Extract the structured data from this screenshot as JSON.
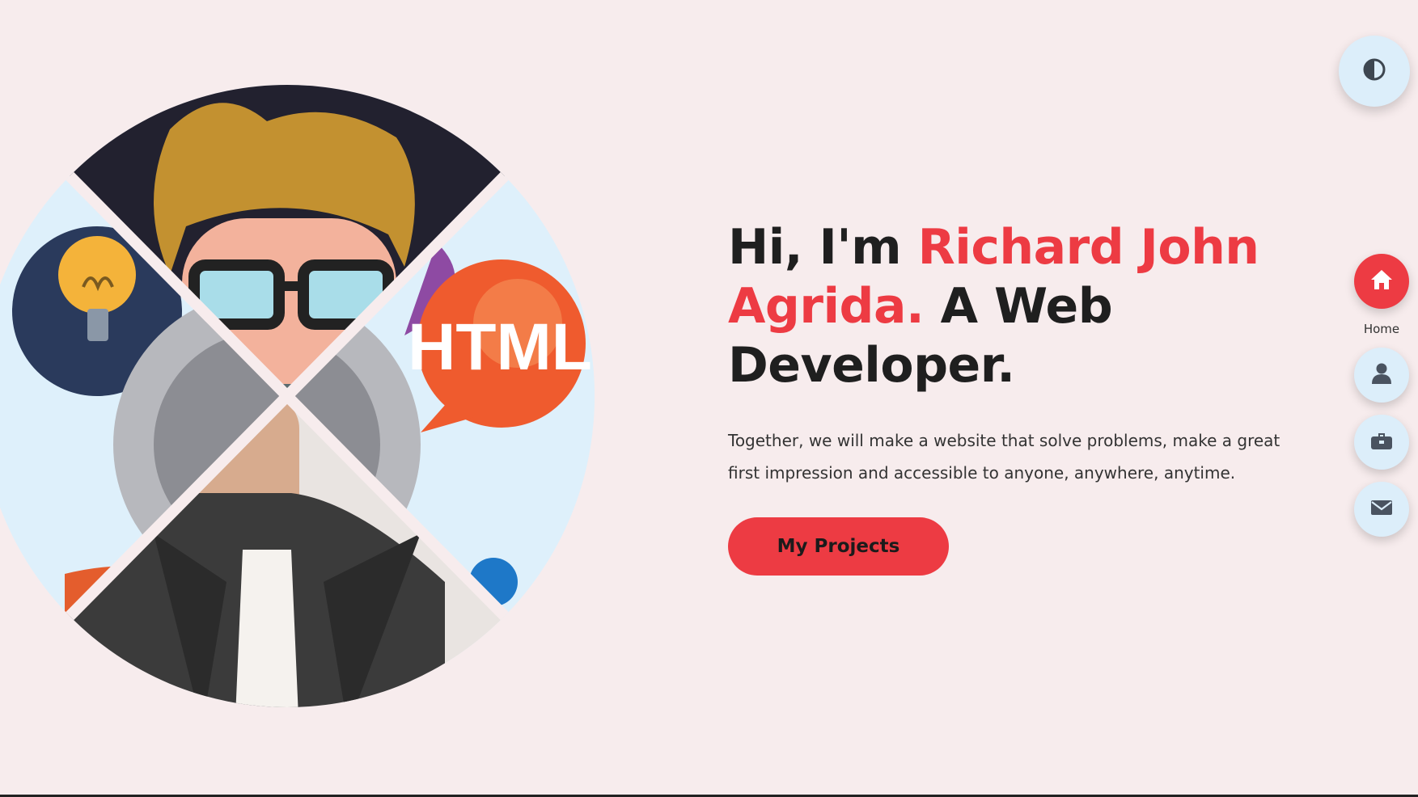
{
  "hero": {
    "title_prefix": "Hi, I'm ",
    "title_name": "Richard John Agrida.",
    "title_suffix": " A Web Developer.",
    "description": "Together, we will make a website that solve problems, make a great first impression and accessible to anyone, anywhere, anytime.",
    "cta_label": "My Projects",
    "illustration_badge": "HTML"
  },
  "nav": {
    "theme_toggle_icon": "contrast-icon",
    "items": [
      {
        "label": "Home",
        "icon": "home-icon",
        "active": true
      },
      {
        "label": "",
        "icon": "user-icon",
        "active": false
      },
      {
        "label": "",
        "icon": "briefcase-icon",
        "active": false
      },
      {
        "label": "",
        "icon": "envelope-icon",
        "active": false
      }
    ]
  },
  "colors": {
    "background": "#f7eced",
    "accent": "#ed3b43",
    "nav_button": "#dceefa",
    "text": "#1f1f1f"
  }
}
